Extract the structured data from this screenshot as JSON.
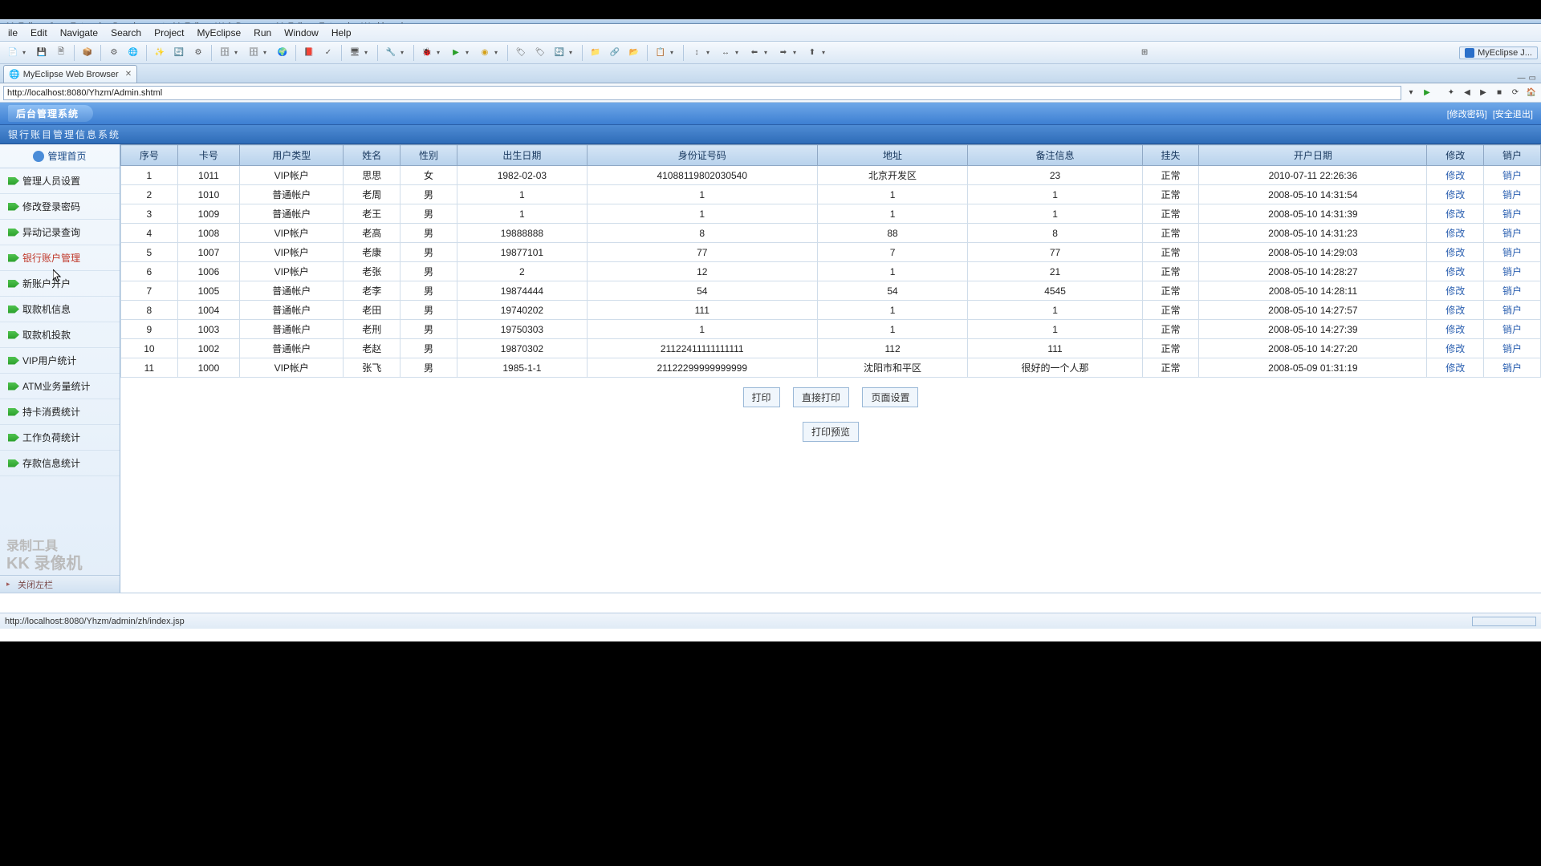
{
  "window_title": "MyEclipse Java Enterprise Development - MyEclipse Web Browser - MyEclipse Enterprise Workbench",
  "menubar": [
    "ile",
    "Edit",
    "Navigate",
    "Search",
    "Project",
    "MyEclipse",
    "Run",
    "Window",
    "Help"
  ],
  "perspective": "MyEclipse J...",
  "editor_tab": "MyEclipse Web Browser",
  "url": "http://localhost:8080/Yhzm/Admin.shtml",
  "header_logo": "后台管理系统",
  "header_links": {
    "pw": "[修改密码]",
    "exit": "[安全退出]"
  },
  "sub_header": "银行账目管理信息系统",
  "side_home": "管理首页",
  "side_items": [
    "管理人员设置",
    "修改登录密码",
    "异动记录查询",
    "银行账户管理",
    "新账户开户",
    "取款机信息",
    "取款机投款",
    "VIP用户统计",
    "ATM业务量统计",
    "持卡消费统计",
    "工作负荷统计",
    "存款信息统计"
  ],
  "side_active_index": 3,
  "side_close": "关闭左栏",
  "side_logo1": "录制工具",
  "side_logo2": "KK 录像机",
  "columns": [
    "序号",
    "卡号",
    "用户类型",
    "姓名",
    "性别",
    "出生日期",
    "身份证号码",
    "地址",
    "备注信息",
    "挂失",
    "开户日期",
    "修改",
    "销户"
  ],
  "rows": [
    {
      "n": "1",
      "card": "1011",
      "type": "VIP帐户",
      "name": "思思",
      "sex": "女",
      "birth": "1982-02-03",
      "id": "41088119802030540",
      "addr": "北京开发区",
      "note": "23",
      "loss": "正常",
      "open": "2010-07-11 22:26:36",
      "mod": "修改",
      "del": "销户"
    },
    {
      "n": "2",
      "card": "1010",
      "type": "普通帐户",
      "name": "老周",
      "sex": "男",
      "birth": "1",
      "id": "1",
      "addr": "1",
      "note": "1",
      "loss": "正常",
      "open": "2008-05-10 14:31:54",
      "mod": "修改",
      "del": "销户"
    },
    {
      "n": "3",
      "card": "1009",
      "type": "普通帐户",
      "name": "老王",
      "sex": "男",
      "birth": "1",
      "id": "1",
      "addr": "1",
      "note": "1",
      "loss": "正常",
      "open": "2008-05-10 14:31:39",
      "mod": "修改",
      "del": "销户"
    },
    {
      "n": "4",
      "card": "1008",
      "type": "VIP帐户",
      "name": "老高",
      "sex": "男",
      "birth": "19888888",
      "id": "8",
      "addr": "88",
      "note": "8",
      "loss": "正常",
      "open": "2008-05-10 14:31:23",
      "mod": "修改",
      "del": "销户"
    },
    {
      "n": "5",
      "card": "1007",
      "type": "VIP帐户",
      "name": "老康",
      "sex": "男",
      "birth": "19877101",
      "id": "77",
      "addr": "7",
      "note": "77",
      "loss": "正常",
      "open": "2008-05-10 14:29:03",
      "mod": "修改",
      "del": "销户"
    },
    {
      "n": "6",
      "card": "1006",
      "type": "VIP帐户",
      "name": "老张",
      "sex": "男",
      "birth": "2",
      "id": "12",
      "addr": "1",
      "note": "21",
      "loss": "正常",
      "open": "2008-05-10 14:28:27",
      "mod": "修改",
      "del": "销户"
    },
    {
      "n": "7",
      "card": "1005",
      "type": "普通帐户",
      "name": "老李",
      "sex": "男",
      "birth": "19874444",
      "id": "54",
      "addr": "54",
      "note": "4545",
      "loss": "正常",
      "open": "2008-05-10 14:28:11",
      "mod": "修改",
      "del": "销户"
    },
    {
      "n": "8",
      "card": "1004",
      "type": "普通帐户",
      "name": "老田",
      "sex": "男",
      "birth": "19740202",
      "id": "111",
      "addr": "1",
      "note": "1",
      "loss": "正常",
      "open": "2008-05-10 14:27:57",
      "mod": "修改",
      "del": "销户"
    },
    {
      "n": "9",
      "card": "1003",
      "type": "普通帐户",
      "name": "老刑",
      "sex": "男",
      "birth": "19750303",
      "id": "1",
      "addr": "1",
      "note": "1",
      "loss": "正常",
      "open": "2008-05-10 14:27:39",
      "mod": "修改",
      "del": "销户"
    },
    {
      "n": "10",
      "card": "1002",
      "type": "普通帐户",
      "name": "老赵",
      "sex": "男",
      "birth": "19870302",
      "id": "21122411111111111",
      "addr": "112",
      "note": "111",
      "loss": "正常",
      "open": "2008-05-10 14:27:20",
      "mod": "修改",
      "del": "销户"
    },
    {
      "n": "11",
      "card": "1000",
      "type": "VIP帐户",
      "name": "张飞",
      "sex": "男",
      "birth": "1985-1-1",
      "id": "21122299999999999",
      "addr": "沈阳市和平区",
      "note": "很好的一个人那",
      "loss": "正常",
      "open": "2008-05-09 01:31:19",
      "mod": "修改",
      "del": "销户"
    }
  ],
  "buttons": {
    "print": "打印",
    "direct": "直接打印",
    "page": "页面设置",
    "preview": "打印预览"
  },
  "status_url": "http://localhost:8080/Yhzm/admin/zh/index.jsp"
}
